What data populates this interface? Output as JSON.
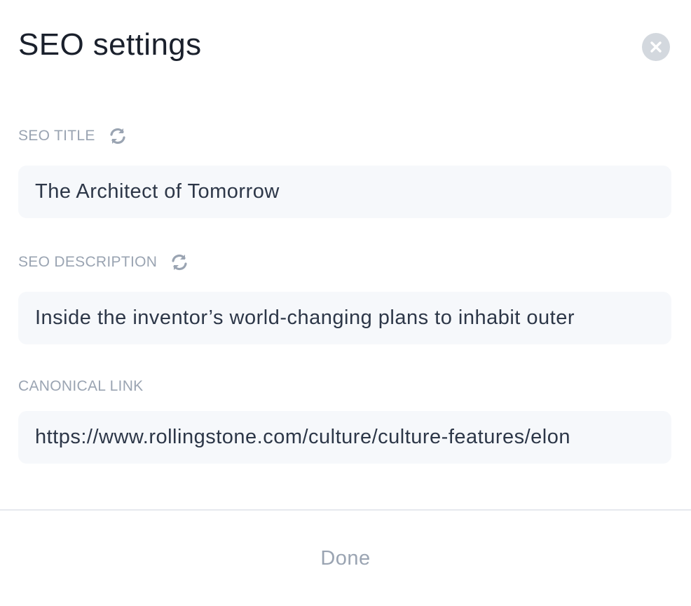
{
  "dialog": {
    "title": "SEO settings",
    "close_icon": "close-icon"
  },
  "fields": {
    "seo_title": {
      "label": "SEO TITLE",
      "value": "The Architect of Tomorrow",
      "icon": "refresh-icon"
    },
    "seo_description": {
      "label": "SEO DESCRIPTION",
      "value": "Inside the inventor’s world-changing plans to inhabit outer",
      "icon": "refresh-icon"
    },
    "canonical_link": {
      "label": "CANONICAL LINK",
      "value": "https://www.rollingstone.com/culture/culture-features/elon"
    }
  },
  "footer": {
    "done_label": "Done"
  },
  "colors": {
    "label": "#9aa4b2",
    "input_bg": "#f6f8fb",
    "close_bg": "#d3d8de",
    "text": "#1a202c"
  }
}
